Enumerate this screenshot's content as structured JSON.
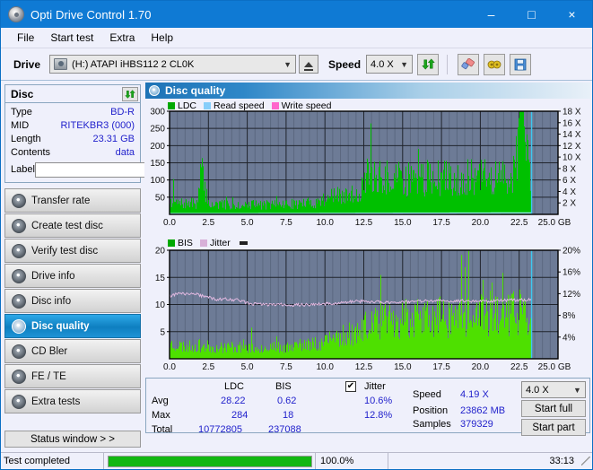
{
  "window": {
    "title": "Opti Drive Control 1.70",
    "icon": "disc-icon",
    "minimize": "–",
    "maximize": "□",
    "close": "×"
  },
  "menu": {
    "items": [
      "File",
      "Start test",
      "Extra",
      "Help"
    ]
  },
  "toolbar": {
    "drive_label": "Drive",
    "drive_value": "(H:)  ATAPI iHBS112  2 CL0K",
    "eject_icon": "eject-icon",
    "speed_label": "Speed",
    "speed_value": "4.0 X",
    "refresh_icon": "refresh-icon",
    "eraser_icon": "eraser-icon",
    "tools_icon": "tools-icon",
    "save_icon": "save-icon"
  },
  "disc": {
    "title": "Disc",
    "refresh_icon": "refresh-icon",
    "rows": [
      {
        "key": "Type",
        "value": "BD-R"
      },
      {
        "key": "MID",
        "value": "RITEKBR3 (000)"
      },
      {
        "key": "Length",
        "value": "23.31 GB"
      },
      {
        "key": "Contents",
        "value": "data"
      }
    ],
    "label_key": "Label",
    "label_value": "",
    "label_placeholder": "",
    "label_button_icon": "cd-icon"
  },
  "nav": {
    "items": [
      {
        "label": "Transfer rate",
        "icon": "disc-icon",
        "active": false
      },
      {
        "label": "Create test disc",
        "icon": "disc-icon",
        "active": false
      },
      {
        "label": "Verify test disc",
        "icon": "disc-icon",
        "active": false
      },
      {
        "label": "Drive info",
        "icon": "disc-icon",
        "active": false
      },
      {
        "label": "Disc info",
        "icon": "disc-icon",
        "active": false
      },
      {
        "label": "Disc quality",
        "icon": "disc-icon",
        "active": true
      },
      {
        "label": "CD Bler",
        "icon": "disc-icon",
        "active": false
      },
      {
        "label": "FE / TE",
        "icon": "disc-icon",
        "active": false
      },
      {
        "label": "Extra tests",
        "icon": "disc-icon",
        "active": false
      }
    ],
    "status_window_button": "Status window > >"
  },
  "panel": {
    "title": "Disc quality",
    "icon": "disc-icon"
  },
  "stats": {
    "col_ldc": "LDC",
    "col_bis": "BIS",
    "row_avg": "Avg",
    "row_max": "Max",
    "row_total": "Total",
    "ldc_avg": "28.22",
    "ldc_max": "284",
    "ldc_total": "10772805",
    "bis_avg": "0.62",
    "bis_max": "18",
    "bis_total": "237088",
    "jitter_label": "Jitter",
    "jitter_checked": true,
    "jitter_check_glyph": "✔",
    "jitter_avg": "10.6%",
    "jitter_max": "12.8%",
    "speed_label": "Speed",
    "speed_value": "4.19 X",
    "position_label": "Position",
    "position_value": "23862 MB",
    "samples_label": "Samples",
    "samples_value": "379329",
    "speed_select": "4.0 X",
    "start_full_button": "Start full",
    "start_part_button": "Start part"
  },
  "statusbar": {
    "message": "Test completed",
    "progress_percent": "100.0%",
    "progress_value": 100,
    "elapsed": "33:13"
  },
  "chart_data": [
    {
      "type": "area",
      "id": "ldc-chart",
      "title": "Disc quality - LDC",
      "xlabel": "GB",
      "ylabel": "",
      "xlim": [
        0,
        25
      ],
      "ylim": [
        0,
        300
      ],
      "y2lim": [
        0,
        18
      ],
      "y2label": "X",
      "xticks": [
        "0.0",
        "2.5",
        "5.0",
        "7.5",
        "10.0",
        "12.5",
        "15.0",
        "17.5",
        "20.0",
        "22.5",
        "25.0 GB"
      ],
      "yticks": [
        "300",
        "250",
        "200",
        "150",
        "100",
        "50"
      ],
      "y2ticks": [
        "18 X",
        "16 X",
        "14 X",
        "12 X",
        "10 X",
        "8 X",
        "6 X",
        "4 X",
        "2 X"
      ],
      "grid": true,
      "plot_bg": "#6d7b96",
      "legend_position": "top-left",
      "legend": [
        {
          "name": "LDC",
          "color": "#00b000"
        },
        {
          "name": "Read speed",
          "color": "#87cefa"
        },
        {
          "name": "Write speed",
          "color": "#ff66cc"
        }
      ],
      "data_end_gb": 23.3,
      "series": [
        {
          "name": "LDC",
          "kind": "bars",
          "color": "#00c000",
          "units": "errors",
          "baseline_by_gb": [
            [
              0.0,
              45
            ],
            [
              0.5,
              34
            ],
            [
              1.0,
              33
            ],
            [
              1.8,
              36
            ],
            [
              2.0,
              137
            ],
            [
              2.5,
              32
            ],
            [
              3.5,
              30
            ],
            [
              4.5,
              31
            ],
            [
              5.5,
              30
            ],
            [
              6.5,
              31
            ],
            [
              7.5,
              32
            ],
            [
              8.5,
              34
            ],
            [
              9.5,
              38
            ],
            [
              10.0,
              52
            ],
            [
              10.5,
              60
            ],
            [
              11.0,
              55
            ],
            [
              11.5,
              58
            ],
            [
              12.2,
              70
            ],
            [
              12.5,
              115
            ],
            [
              13.0,
              118
            ],
            [
              14.0,
              112
            ],
            [
              15.0,
              110
            ],
            [
              16.0,
              112
            ],
            [
              17.0,
              115
            ],
            [
              18.0,
              113
            ],
            [
              19.0,
              114
            ],
            [
              20.0,
              116
            ],
            [
              21.0,
              115
            ],
            [
              22.0,
              118
            ],
            [
              22.6,
              284
            ],
            [
              23.3,
              115
            ]
          ]
        },
        {
          "name": "Read speed",
          "kind": "line",
          "color": "#9fe8ff",
          "units": "X",
          "points_by_gb": [
            [
              0.0,
              2.0
            ],
            [
              2.5,
              2.05
            ],
            [
              5.0,
              2.2
            ],
            [
              7.5,
              2.4
            ],
            [
              10.0,
              2.6
            ],
            [
              12.5,
              3.0
            ],
            [
              15.0,
              3.3
            ],
            [
              17.5,
              3.5
            ],
            [
              20.0,
              3.8
            ],
            [
              22.5,
              4.1
            ],
            [
              23.3,
              4.19
            ]
          ]
        },
        {
          "name": "Write speed",
          "kind": "line",
          "color": "#ff66cc",
          "units": "X",
          "points_by_gb": []
        }
      ],
      "cursor_gb": 23.3,
      "cursor_color": "#3ec8f0"
    },
    {
      "type": "area",
      "id": "bis-jitter-chart",
      "title": "Disc quality - BIS / Jitter",
      "xlabel": "GB",
      "ylabel": "",
      "xlim": [
        0,
        25
      ],
      "ylim": [
        0,
        20
      ],
      "y2lim": [
        0,
        20
      ],
      "y2label": "%",
      "xticks": [
        "0.0",
        "2.5",
        "5.0",
        "7.5",
        "10.0",
        "12.5",
        "15.0",
        "17.5",
        "20.0",
        "22.5",
        "25.0 GB"
      ],
      "yticks": [
        "20",
        "15",
        "10",
        "5"
      ],
      "y2ticks": [
        "20%",
        "16%",
        "12%",
        "8%",
        "4%"
      ],
      "grid": true,
      "plot_bg": "#6d7b96",
      "legend_position": "top-left",
      "legend": [
        {
          "name": "BIS",
          "color": "#00b000"
        },
        {
          "name": "Jitter",
          "color": "#d8b0d8"
        }
      ],
      "data_end_gb": 23.3,
      "series": [
        {
          "name": "BIS",
          "kind": "bars",
          "color": "#4ee000",
          "units": "errors",
          "baseline_by_gb": [
            [
              0.0,
              3.0
            ],
            [
              1.0,
              2.4
            ],
            [
              2.0,
              2.6
            ],
            [
              3.0,
              2.2
            ],
            [
              4.0,
              2.4
            ],
            [
              5.0,
              2.3
            ],
            [
              6.0,
              2.2
            ],
            [
              7.0,
              2.3
            ],
            [
              8.0,
              2.5
            ],
            [
              9.0,
              2.8
            ],
            [
              10.0,
              3.4
            ],
            [
              11.0,
              4.6
            ],
            [
              12.0,
              5.4
            ],
            [
              13.0,
              6.8
            ],
            [
              14.0,
              7.4
            ],
            [
              15.0,
              7.8
            ],
            [
              16.0,
              8.0
            ],
            [
              17.0,
              8.2
            ],
            [
              18.0,
              8.4
            ],
            [
              19.0,
              8.6
            ],
            [
              20.0,
              8.8
            ],
            [
              21.0,
              9.0
            ],
            [
              22.0,
              9.2
            ],
            [
              23.0,
              9.6
            ],
            [
              23.3,
              9.8
            ]
          ],
          "max_spike": 18
        },
        {
          "name": "Jitter",
          "kind": "line",
          "color": "#e0b8e0",
          "units": "%",
          "points_by_gb": [
            [
              0.0,
              11.6
            ],
            [
              0.5,
              12.0
            ],
            [
              1.0,
              11.9
            ],
            [
              1.5,
              12.1
            ],
            [
              2.0,
              11.6
            ],
            [
              2.5,
              11.3
            ],
            [
              3.0,
              10.9
            ],
            [
              3.5,
              11.0
            ],
            [
              4.0,
              10.9
            ],
            [
              4.5,
              10.8
            ],
            [
              5.0,
              10.2
            ],
            [
              6.0,
              10.0
            ],
            [
              7.0,
              10.0
            ],
            [
              8.0,
              9.9
            ],
            [
              9.0,
              10.0
            ],
            [
              10.0,
              10.1
            ],
            [
              11.0,
              10.3
            ],
            [
              12.0,
              10.6
            ],
            [
              13.0,
              10.5
            ],
            [
              14.0,
              10.4
            ],
            [
              15.0,
              10.5
            ],
            [
              16.0,
              10.6
            ],
            [
              17.0,
              10.7
            ],
            [
              18.0,
              10.6
            ],
            [
              19.0,
              10.7
            ],
            [
              20.0,
              10.6
            ],
            [
              21.0,
              10.7
            ],
            [
              22.0,
              10.8
            ],
            [
              23.3,
              10.9
            ]
          ]
        }
      ],
      "cursor_gb": 23.3,
      "cursor_color": "#3ec8f0"
    }
  ]
}
